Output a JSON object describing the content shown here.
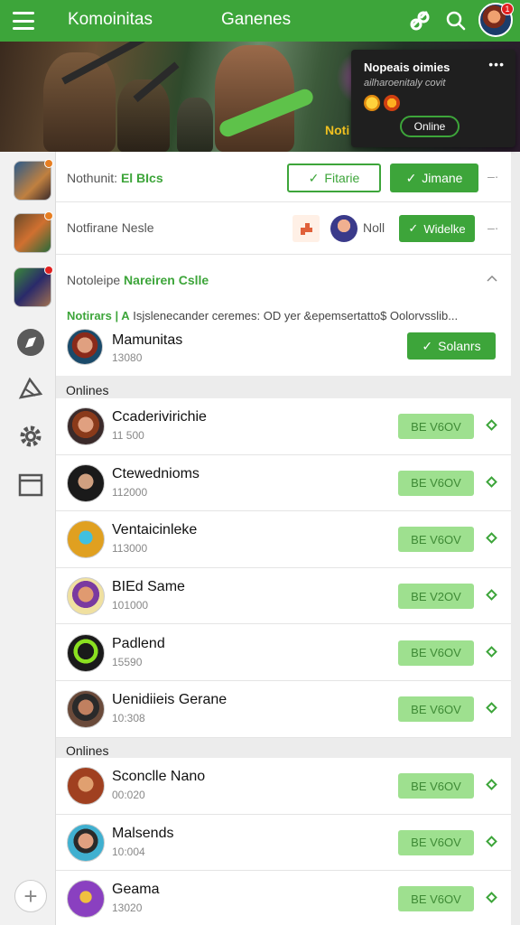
{
  "topbar": {
    "tab1": "Komoinitas",
    "tab2": "Ganenes",
    "badge": "1"
  },
  "banner": {
    "tag": "Noti"
  },
  "popup": {
    "title": "Nopeais oimies",
    "subtitle": "ailharoenitaly covit",
    "more": "•••",
    "button": "Online"
  },
  "rows": {
    "r1": {
      "label": "Nothunit:",
      "label_green": "El BIcs",
      "btn_outline": "Fitarie",
      "btn_solid": "Jimane"
    },
    "r2": {
      "label": "Notfirane Nesle",
      "mini_label": "Noll",
      "btn_solid": "Widelke"
    },
    "r3": {
      "label": "Notoleipe",
      "label_green": "Nareiren Cslle"
    },
    "banner_text_green": "Notirars | A",
    "banner_text": "Isjslenecander ceremes: OD yer &epemsertatto$ Oolorvsslib...",
    "feature": {
      "name": "Mamunitas",
      "sub": "13080",
      "btn": "Solanrs"
    }
  },
  "section1": {
    "label": "Onlines",
    "items": [
      {
        "name": "Ccaderivirichie",
        "sub": "11 500",
        "action": "BE V6OV"
      },
      {
        "name": "Ctewednioms",
        "sub": "112000",
        "action": "BE V6OV"
      },
      {
        "name": "Ventaicinleke",
        "sub": "113000",
        "action": "BE V6OV"
      },
      {
        "name": "BIEd Same",
        "sub": "101000",
        "action": "BE V2OV"
      },
      {
        "name": "Padlend",
        "sub": "15590",
        "action": "BE V6OV"
      },
      {
        "name": "Uenidiieis Gerane",
        "sub": "10:308",
        "action": "BE V6OV"
      }
    ]
  },
  "section2": {
    "label": "Onlines",
    "items": [
      {
        "name": "Sconclle Nano",
        "sub": "00:020",
        "action": "BE V6OV"
      },
      {
        "name": "Malsends",
        "sub": "10:004",
        "action": "BE V6OV"
      },
      {
        "name": "Geama",
        "sub": "13020",
        "action": "BE V6OV"
      }
    ]
  },
  "icons": {
    "menu": "hamburger-icon",
    "links": "link-icon",
    "search": "search-icon",
    "rail": [
      "compass-icon",
      "kite-icon",
      "gear-icon",
      "window-icon",
      "plus-icon"
    ]
  },
  "colors": {
    "brand_green": "#3da53a",
    "action_green_light": "#9ee08f",
    "popup_bg": "#1f1f1f"
  }
}
